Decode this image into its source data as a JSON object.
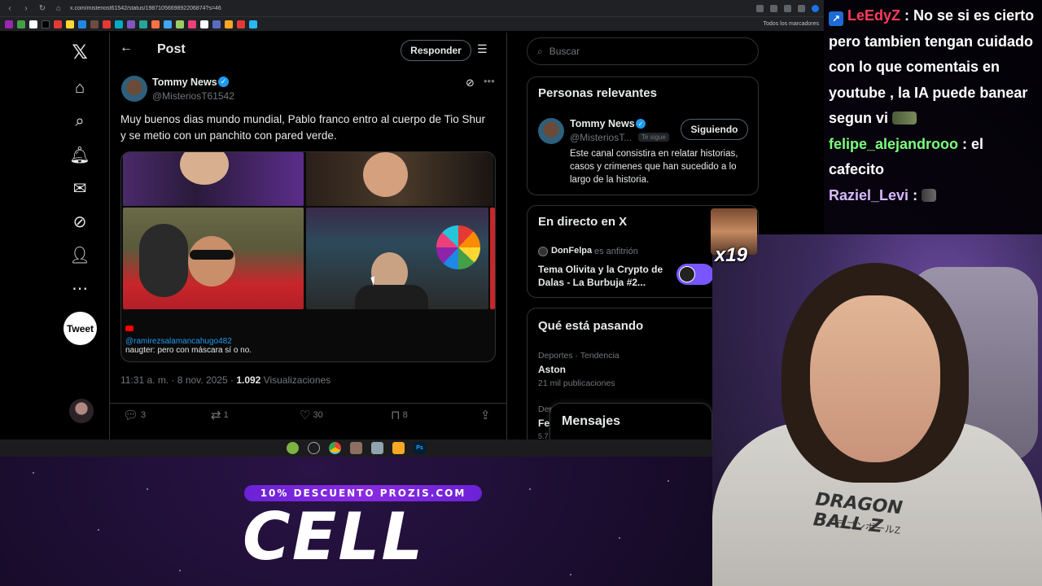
{
  "browser": {
    "url": "x.com/misteriost61542/status/1987105669892206874?s=46",
    "bookmarks_all_label": "Todos los marcadores"
  },
  "nav": {
    "tweet_button": "Tweet"
  },
  "post": {
    "header_title": "Post",
    "reply_button": "Responder",
    "author_name": "Tommy News",
    "author_handle": "@MisteriosT61542",
    "text": "Muy buenos dias mundo mundial, Pablo franco entro al cuerpo de Tio Shur y se metio con un panchito con pared verde.",
    "media_chat_user": "@ramirezsalamancahugo482",
    "media_chat_message": "naugter: pero con máscara sí o no.",
    "timestamp": "11:31 a. m. · 8 nov. 2025 · ",
    "views_count": "1.092",
    "views_label": " Visualizaciones",
    "actions": {
      "replies": "3",
      "reposts": "1",
      "likes": "30",
      "bookmarks": "8"
    }
  },
  "sidebar": {
    "search_placeholder": "Buscar",
    "relevant_title": "Personas relevantes",
    "relevant_name": "Tommy News",
    "relevant_handle": "@MisteriosT...",
    "relevant_follows_you": "Te sigue",
    "relevant_follow_button": "Siguiendo",
    "relevant_bio": "Este canal consistira en relatar historias, casos y crimenes que han sucedido a lo largo de la historia.",
    "live_title": "En directo en X",
    "live_host": "DonFelpa",
    "live_host_role": "es anfitrión",
    "live_topic": "Tema Olivita y la Crypto de Dalas - La Burbuja #2...",
    "trends_title": "Qué está pasando",
    "trend_meta": "Deportes · Tendencia",
    "trend_name": "Aston",
    "trend_count": "21 mil publicaciones",
    "trend2_meta": "Depo",
    "trend2_name": "Fe",
    "trend2_count": "5.7",
    "messages_label": "Mensajes"
  },
  "promo": {
    "discount": "10% DESCUENTO PROZIS.COM",
    "brand": "CELL"
  },
  "stream_chat": {
    "messages": [
      {
        "user": "LeEdyZ",
        "color": "#ff3b5c",
        "text": " : No se si es cierto pero tambien tengan cuidado con lo que comentais en youtube , la IA puede banear segun vi"
      },
      {
        "user": "felipe_alejandrooo",
        "color": "#7cff7c",
        "text": " : el cafecito"
      },
      {
        "user": "Raziel_Levi",
        "color": "#d9b8ff",
        "text": " : "
      }
    ]
  },
  "emote_popup": {
    "count": "x19"
  },
  "webcam": {
    "hoodie_print": "DRAGON BALL Z",
    "hoodie_print_sub": "ドラゴンボールZ"
  },
  "colors": {
    "accent": "#1d9bf0",
    "promo_purple": "#7a2be2"
  }
}
